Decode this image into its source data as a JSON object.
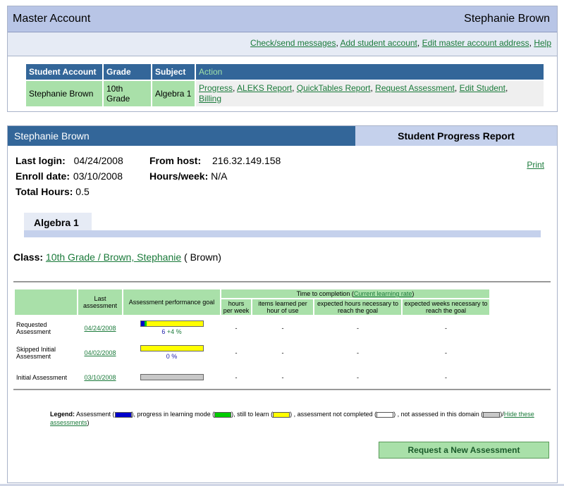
{
  "master": {
    "title": "Master Account",
    "user": "Stephanie Brown",
    "links": [
      "Check/send messages",
      "Add student account",
      "Edit master account address",
      "Help"
    ],
    "table": {
      "headers": [
        "Student Account",
        "Grade",
        "Subject",
        "Action"
      ],
      "row": {
        "student": "Stephanie Brown",
        "grade": "10th Grade",
        "subject": "Algebra 1",
        "actions": [
          "Progress",
          "ALEKS Report",
          "QuickTables Report",
          "Request Assessment",
          "Edit Student",
          "Billing"
        ]
      }
    }
  },
  "student": {
    "name": "Stephanie Brown",
    "report_title": "Student Progress Report",
    "last_login_label": "Last login:",
    "last_login": "04/24/2008",
    "from_host_label": "From host:",
    "from_host": "216.32.149.158",
    "enroll_label": "Enroll date:",
    "enroll": "03/10/2008",
    "hours_week_label": "Hours/week:",
    "hours_week": "N/A",
    "total_hours_label": "Total Hours:",
    "total_hours": "0.5",
    "print": "Print",
    "tab": "Algebra 1",
    "class_label": "Class:",
    "class_link": "10th Grade / Brown, Stephanie",
    "class_teacher": "( Brown)"
  },
  "progress": {
    "headers": {
      "last_assessment": "Last assessment",
      "goal": "Assessment performance goal",
      "time_to_completion": "Time to completion (",
      "current_rate": "Current learning rate",
      "close_paren": ")",
      "hours_per_week": "hours per week",
      "items_per_hour": "items learned per hour of use",
      "expected_hours": "expected hours necessary to reach the goal",
      "expected_weeks": "expected weeks necessary to reach the goal"
    },
    "rows": [
      {
        "label": "Requested Assessment",
        "date": "04/24/2008",
        "assessed": 0.06,
        "progress": 0.04,
        "pct": "6",
        "plus": "+4 %",
        "hpw": "-",
        "iph": "-",
        "eh": "-",
        "ew": "-",
        "bar": "yellow"
      },
      {
        "label": "Skipped Initial Assessment",
        "date": "04/02/2008",
        "assessed": 0,
        "progress": 0,
        "pct": "0 %",
        "plus": "",
        "hpw": "-",
        "iph": "-",
        "eh": "-",
        "ew": "-",
        "bar": "yellow"
      },
      {
        "label": "Initial Assessment",
        "date": "03/10/2008",
        "assessed": 0,
        "progress": 0,
        "pct": "",
        "plus": "",
        "hpw": "-",
        "iph": "-",
        "eh": "-",
        "ew": "-",
        "bar": "gray"
      }
    ]
  },
  "legend": {
    "label": "Legend:",
    "assessment": " Assessment (",
    "progress": "), progress in learning mode (",
    "still": "), still to learn (",
    "not_completed": ") , assessment not completed (",
    "not_assessed": ") , not assessed in this domain (",
    "slash": ")/",
    "hide": "Hide these assessments",
    "end": ")"
  },
  "button": "Request a New Assessment",
  "colors": {
    "assessment": "#0000cc",
    "progress": "#00cc00",
    "still": "#ffff00",
    "not_completed": "#ffffff",
    "not_assessed": "#c8c8c8"
  }
}
